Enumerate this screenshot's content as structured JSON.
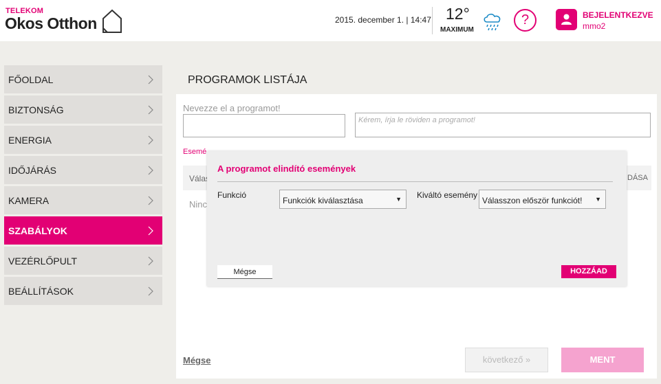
{
  "header": {
    "brand_small": "TELEKOM",
    "brand_big": "Okos Otthon",
    "datetime": "2015. december 1. | 14:47",
    "temperature": "12°",
    "temperature_label": "MAXIMUM",
    "weather_icon": "rain-cloud-icon",
    "help_label": "?",
    "user_status": "BEJELENTKEZVE",
    "user_name": "mmo2",
    "accent_color": "#e20074"
  },
  "sidebar": {
    "items": [
      {
        "label": "FŐOLDAL",
        "active": false
      },
      {
        "label": "BIZTONSÁG",
        "active": false
      },
      {
        "label": "ENERGIA",
        "active": false
      },
      {
        "label": "IDŐJÁRÁS",
        "active": false
      },
      {
        "label": "KAMERA",
        "active": false
      },
      {
        "label": "SZABÁLYOK",
        "active": true
      },
      {
        "label": "VEZÉRLŐPULT",
        "active": false
      },
      {
        "label": "BEÁLLÍTÁSOK",
        "active": false
      }
    ]
  },
  "main": {
    "title": "PROGRAMOK LISTÁJA",
    "name_label": "Nevezze el a programot!",
    "name_value": "",
    "desc_placeholder": "Kérem, írja le röviden a programot!",
    "tab_partial": "Esemé",
    "table_header_left": "Válas",
    "table_header_right": "DÁSA",
    "empty_text": "Ninc",
    "cancel_label": "Mégse",
    "next_label": "következő »",
    "save_label": "MENT"
  },
  "modal": {
    "title": "A programot elindító események",
    "function_label": "Funkció",
    "function_value": "Funkciók kiválasztása",
    "event_label": "Kiváltó esemény",
    "event_value": "Válasszon először funkciót!",
    "cancel_label": "Mégse",
    "add_label": "HOZZÁAD"
  }
}
